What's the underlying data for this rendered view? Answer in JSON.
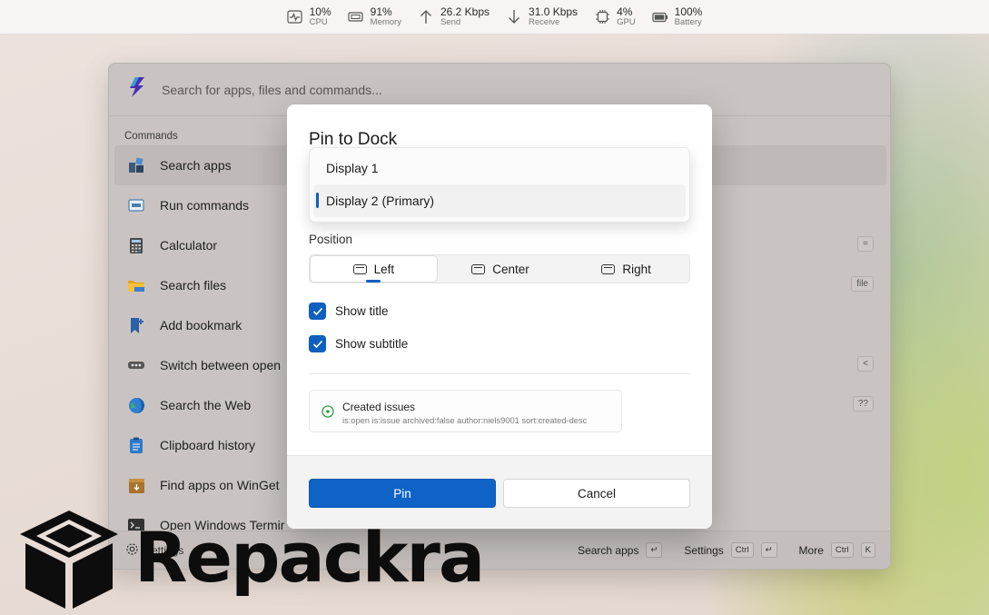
{
  "sysbar": {
    "stats": [
      {
        "value": "10%",
        "label": "CPU",
        "icon": "cpu-pulse-icon"
      },
      {
        "value": "91%",
        "label": "Memory",
        "icon": "memory-icon"
      },
      {
        "value": "26.2 Kbps",
        "label": "Send",
        "icon": "arrow-up-icon"
      },
      {
        "value": "31.0 Kbps",
        "label": "Receive",
        "icon": "arrow-down-icon"
      },
      {
        "value": "4%",
        "label": "GPU",
        "icon": "gpu-chip-icon"
      },
      {
        "value": "100%",
        "label": "Battery",
        "icon": "battery-icon"
      }
    ]
  },
  "palette": {
    "search_placeholder": "Search for apps, files and commands...",
    "section_label": "Commands",
    "commands": [
      {
        "label": "Search apps",
        "icon": "apps-grid-icon"
      },
      {
        "label": "Run commands",
        "icon": "run-window-icon"
      },
      {
        "label": "Calculator",
        "icon": "calculator-icon",
        "shortcut": "="
      },
      {
        "label": "Search files",
        "icon": "folder-icon",
        "shortcut": "file"
      },
      {
        "label": "Add bookmark",
        "icon": "bookmark-add-icon"
      },
      {
        "label": "Switch between open",
        "icon": "window-switch-icon",
        "shortcut": "<"
      },
      {
        "label": "Search the Web",
        "icon": "globe-icon",
        "shortcut": "??"
      },
      {
        "label": "Clipboard history",
        "icon": "clipboard-icon"
      },
      {
        "label": "Find apps on WinGet",
        "icon": "package-icon"
      },
      {
        "label": "Open Windows Termir",
        "icon": "terminal-icon"
      }
    ],
    "footer": {
      "settings_label": "Settings",
      "actions": [
        {
          "label": "Search apps",
          "keys": [
            "↵"
          ]
        },
        {
          "label": "Settings",
          "keys": [
            "Ctrl",
            "↵"
          ]
        },
        {
          "label": "More",
          "keys": [
            "Ctrl",
            "K"
          ]
        }
      ]
    }
  },
  "dialog": {
    "title": "Pin to Dock",
    "display_options": [
      "Display 1",
      "Display 2 (Primary)"
    ],
    "selected_display": "Display 2 (Primary)",
    "position_label": "Position",
    "positions": [
      "Left",
      "Center",
      "Right"
    ],
    "selected_position": "Left",
    "show_title_label": "Show title",
    "show_title_checked": true,
    "show_subtitle_label": "Show subtitle",
    "show_subtitle_checked": true,
    "preview": {
      "title": "Created issues",
      "subtitle": "is:open is:issue archived:false author:niels9001 sort:created-desc"
    },
    "pin_label": "Pin",
    "cancel_label": "Cancel"
  },
  "watermark": {
    "text": "Repackra"
  },
  "colors": {
    "accent": "#0f63c6",
    "indicator": "#0f5fbd"
  }
}
